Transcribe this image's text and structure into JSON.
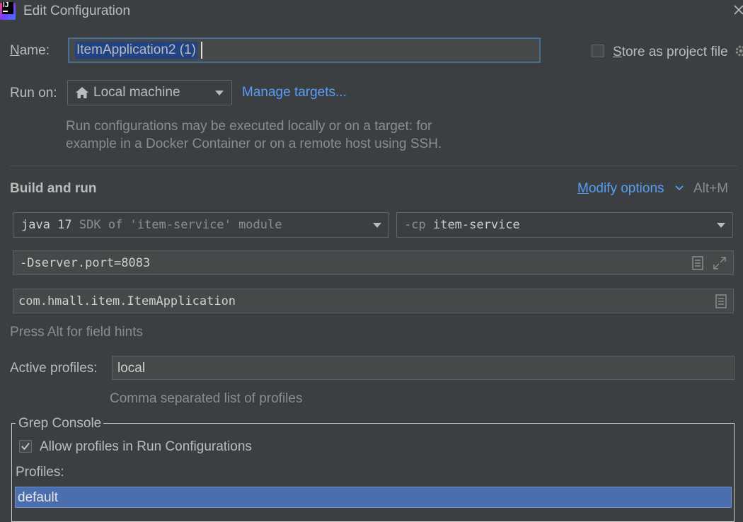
{
  "window": {
    "title": "Edit Configuration",
    "app_icon_text": "IJ"
  },
  "name": {
    "label": "Name:",
    "value": "ItemApplication2 (1)"
  },
  "store_as_project_file": {
    "label": "Store as project file",
    "checked": false
  },
  "run_on": {
    "label": "Run on:",
    "selected": "Local machine",
    "manage_link": "Manage targets...",
    "description_line1": "Run configurations may be executed locally or on a target: for",
    "description_line2": "example in a Docker Container or on a remote host using SSH."
  },
  "build_and_run": {
    "heading": "Build and run",
    "modify_options": "Modify options",
    "modify_shortcut": "Alt+M",
    "jdk_main": "java 17",
    "jdk_detail": "SDK of 'item-service' module",
    "classpath_prefix": "-cp",
    "classpath_module": "item-service",
    "vm_options": "-Dserver.port=8083",
    "main_class": "com.hmall.item.ItemApplication",
    "field_hint": "Press Alt for field hints"
  },
  "active_profiles": {
    "label": "Active profiles:",
    "value": "local",
    "hint": "Comma separated list of profiles"
  },
  "grep_console": {
    "title": "Grep Console",
    "allow_profiles_label": "Allow profiles in Run Configurations",
    "allow_profiles_checked": true,
    "profiles_label": "Profiles:",
    "profiles": [
      "default"
    ]
  },
  "colors": {
    "background": "#3c3f41",
    "text": "#bbbbbb",
    "link": "#589df6",
    "selection": "#4b6eaf",
    "focus_border": "#466d94"
  }
}
